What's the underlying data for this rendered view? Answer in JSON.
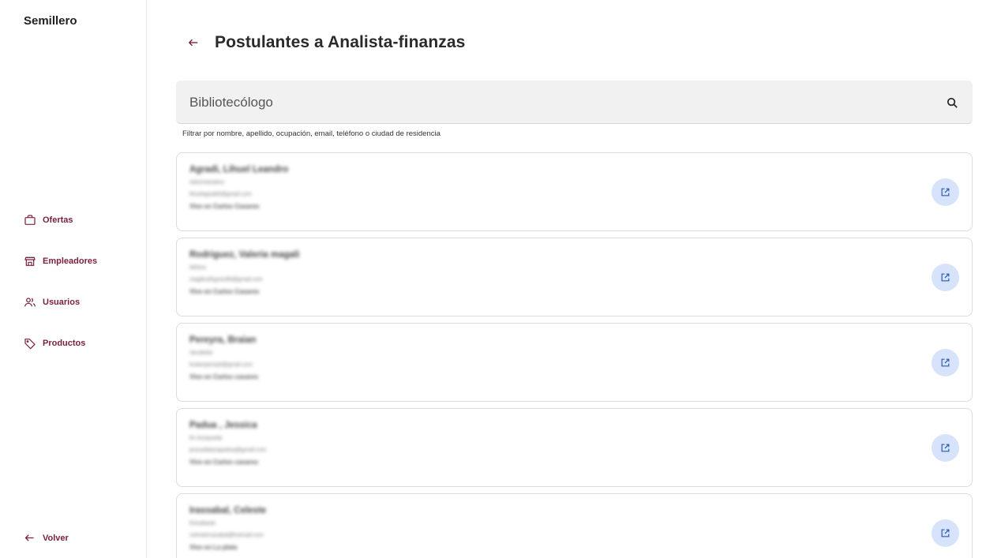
{
  "sidebar": {
    "brand": "Semillero",
    "items": [
      {
        "label": "Ofertas",
        "icon": "briefcase-icon"
      },
      {
        "label": "Empleadores",
        "icon": "storefront-icon"
      },
      {
        "label": "Usuarios",
        "icon": "users-icon"
      },
      {
        "label": "Productos",
        "icon": "tag-icon"
      }
    ],
    "back_label": "Volver"
  },
  "header": {
    "title": "Postulantes a Analista-finanzas"
  },
  "search": {
    "value": "Bibliotecólogo",
    "helper": "Filtrar por nombre, apellido, ocupación, email, teléfono o ciudad de residencia"
  },
  "applicants": [
    {
      "name": "Agradi, Lihuel Leandro",
      "occupation": "Administrativo",
      "email": "lihuelagradi4@gmail.com",
      "city": "Vive en Carlos Casares"
    },
    {
      "name": "Rodriguez, Valeria magali",
      "occupation": "Niñera",
      "email": "magilrodriguez86@gmail.com",
      "city": "Vive en Carlos Casares"
    },
    {
      "name": "Pereyra, Braian",
      "occupation": "Vendedor",
      "email": "braianpereyb@gmail.com",
      "city": "Vive en Carlos casares"
    },
    {
      "name": "Padua , Jessica",
      "occupation": "En busqueda",
      "email": "jesicadaianapadua@gmail.com",
      "city": "Vive en Carlos casares"
    },
    {
      "name": "Irassabal, Celeste",
      "occupation": "Estudiante",
      "email": "celesteirrazabal@hotmail.com",
      "city": "Vive en La plata"
    }
  ],
  "colors": {
    "accent": "#7a1f3d",
    "open_button_bg": "#d7e3fb",
    "open_icon": "#2a5db0"
  }
}
